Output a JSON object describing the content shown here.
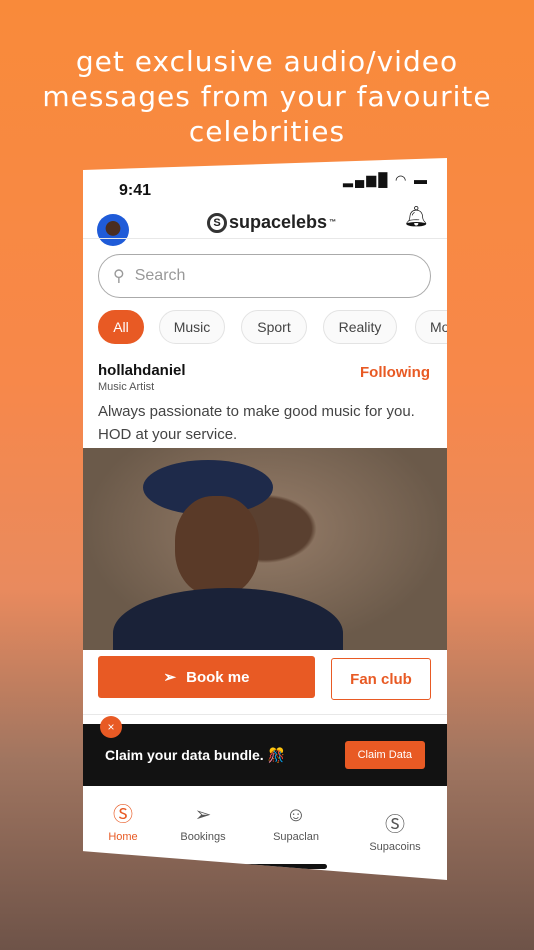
{
  "headline": "get exclusive audio/video messages from your favourite celebrities",
  "status": {
    "time": "9:41",
    "icons": [
      "signal-icon",
      "wifi-icon",
      "battery-icon"
    ]
  },
  "header": {
    "logo": "supacelebs",
    "logo_tm": "™"
  },
  "search": {
    "placeholder": "Search"
  },
  "categories": [
    "All",
    "Music",
    "Sport",
    "Reality",
    "Mo"
  ],
  "celebrity": {
    "name": "hollahdaniel",
    "role": "Music Artist",
    "follow": "Following",
    "bio": "Always passionate to make good music for you. HOD at your service."
  },
  "actions": {
    "book": "Book me",
    "fan": "Fan club"
  },
  "banner": {
    "text": "Claim your data bundle. 🎊",
    "button": "Claim Data",
    "close": "×"
  },
  "nav": [
    {
      "label": "Home",
      "icon": "home-logo-icon"
    },
    {
      "label": "Bookings",
      "icon": "send-icon"
    },
    {
      "label": "Supaclan",
      "icon": "group-icon"
    },
    {
      "label": "Supacoins",
      "icon": "coin-icon"
    }
  ],
  "colors": {
    "accent": "#e85a24",
    "background": "#f98a3a"
  }
}
